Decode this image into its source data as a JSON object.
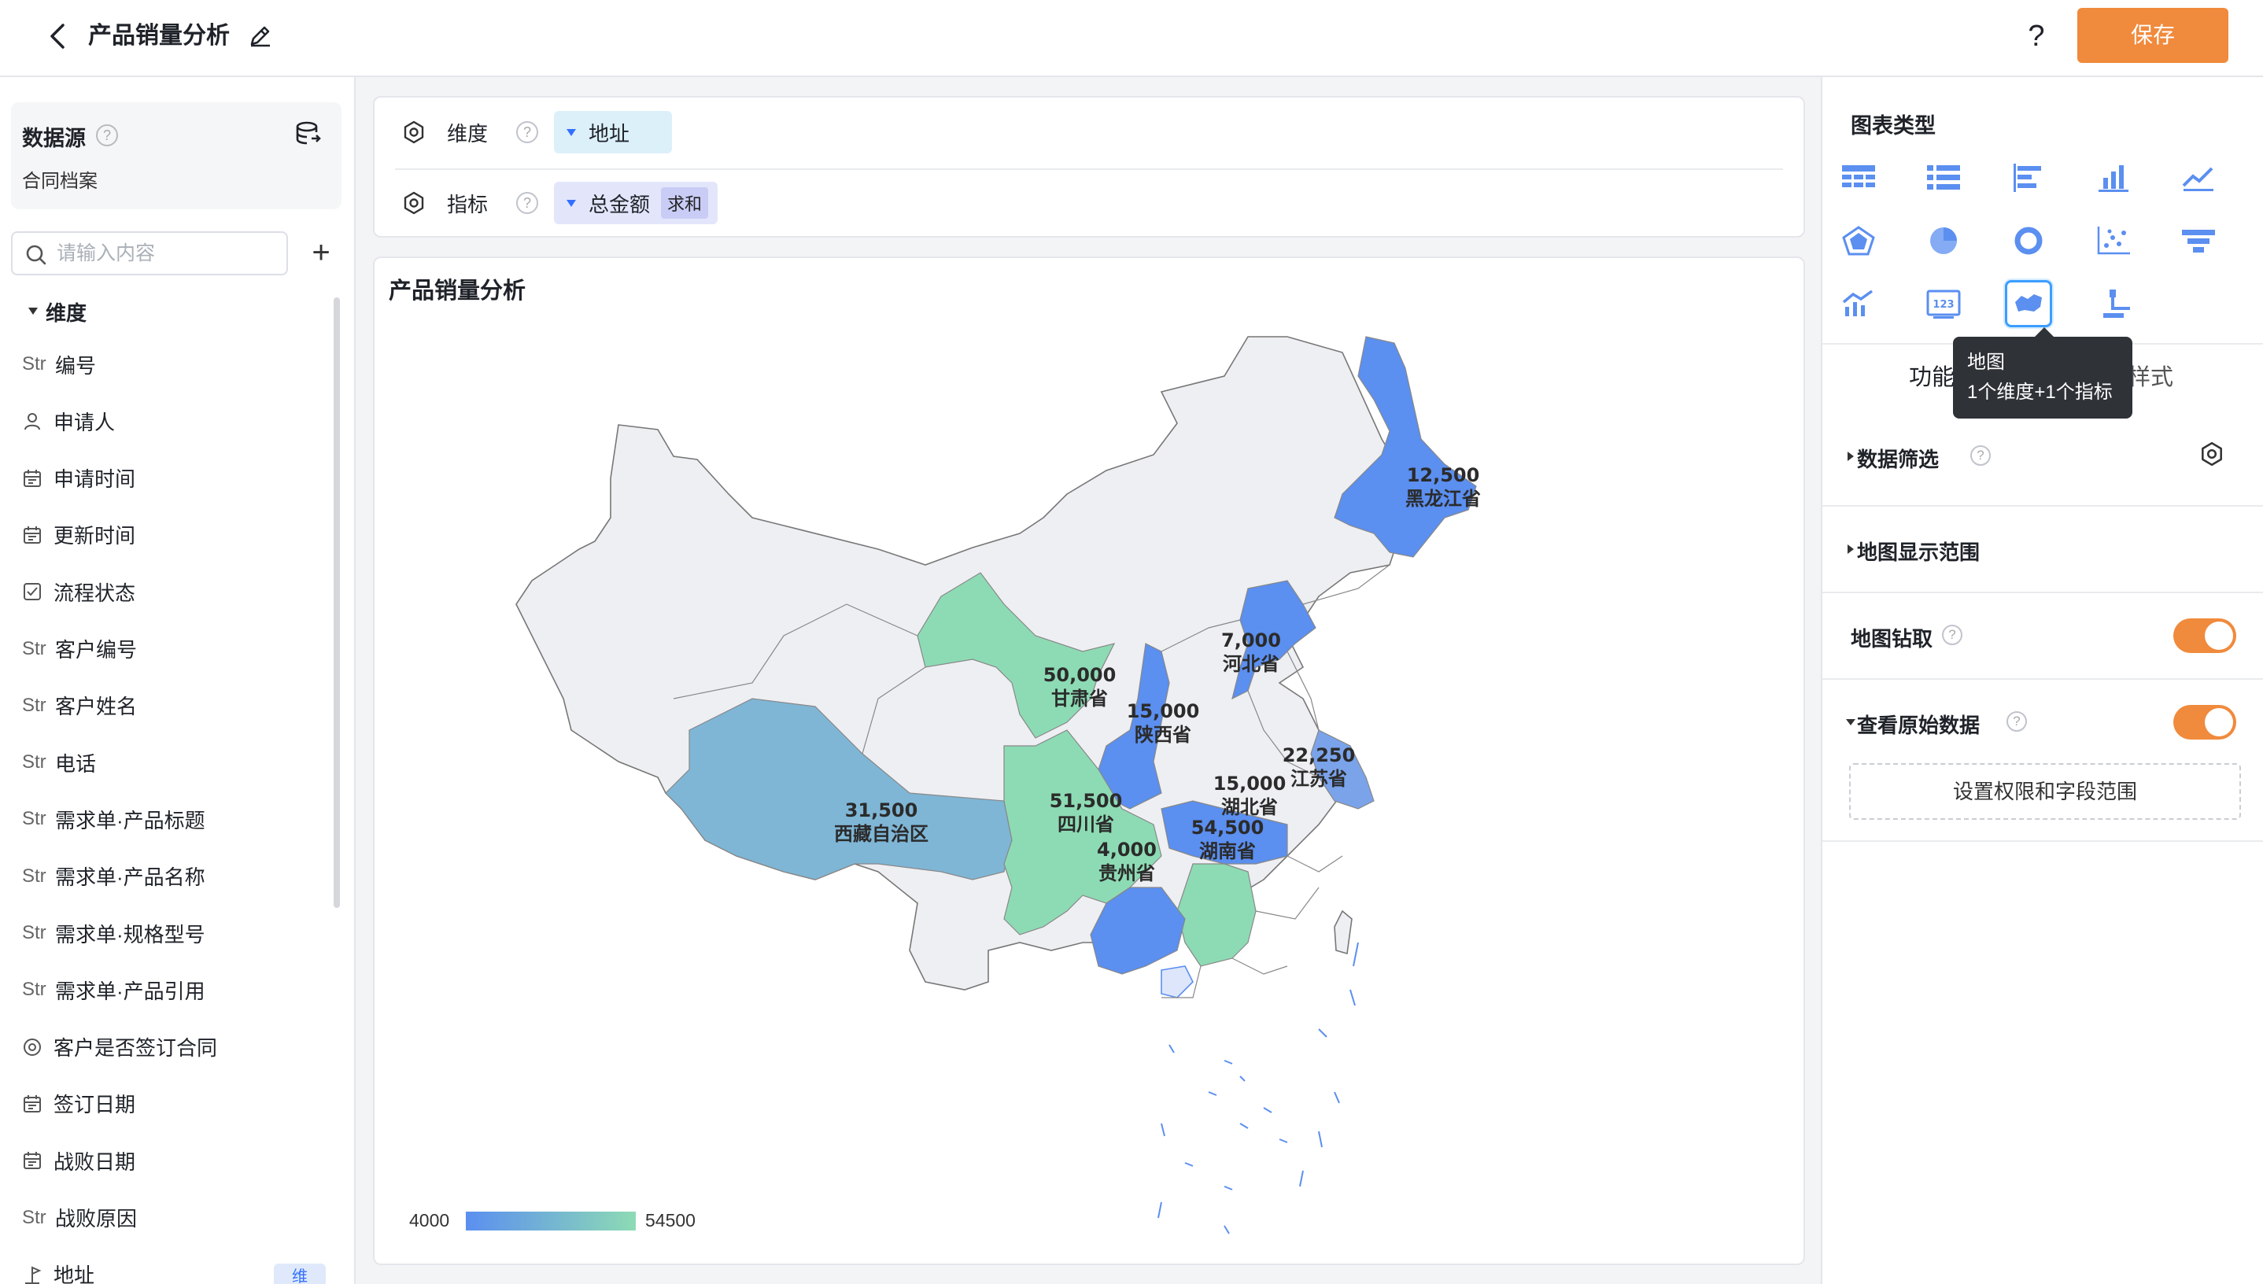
{
  "header": {
    "title": "产品销量分析",
    "help": "?",
    "save_label": "保存"
  },
  "sidebar": {
    "datasource_label": "数据源",
    "datasource_name": "合同档案",
    "search_placeholder": "请输入内容",
    "add": "+",
    "dimension_group": "维度",
    "fields": [
      {
        "type": "Str",
        "icon": "string-icon",
        "label": "编号"
      },
      {
        "type": "",
        "icon": "person-icon",
        "label": "申请人"
      },
      {
        "type": "",
        "icon": "calendar-icon",
        "label": "申请时间"
      },
      {
        "type": "",
        "icon": "calendar-icon",
        "label": "更新时间"
      },
      {
        "type": "",
        "icon": "checkbox-icon",
        "label": "流程状态"
      },
      {
        "type": "Str",
        "icon": "string-icon",
        "label": "客户编号"
      },
      {
        "type": "Str",
        "icon": "string-icon",
        "label": "客户姓名"
      },
      {
        "type": "Str",
        "icon": "string-icon",
        "label": "电话"
      },
      {
        "type": "Str",
        "icon": "string-icon",
        "label": "需求单·产品标题"
      },
      {
        "type": "Str",
        "icon": "string-icon",
        "label": "需求单·产品名称"
      },
      {
        "type": "Str",
        "icon": "string-icon",
        "label": "需求单·规格型号"
      },
      {
        "type": "Str",
        "icon": "string-icon",
        "label": "需求单·产品引用"
      },
      {
        "type": "",
        "icon": "radio-icon",
        "label": "客户是否签订合同"
      },
      {
        "type": "",
        "icon": "calendar-icon",
        "label": "签订日期"
      },
      {
        "type": "",
        "icon": "calendar-icon",
        "label": "战败日期"
      },
      {
        "type": "Str",
        "icon": "string-icon",
        "label": "战败原因"
      },
      {
        "type": "",
        "icon": "location-icon",
        "label": "地址"
      }
    ],
    "address_tag": "维"
  },
  "config": {
    "dimension_label": "维度",
    "dimension_value": "地址",
    "metric_label": "指标",
    "metric_value": "总金额",
    "metric_agg": "求和"
  },
  "chart": {
    "title": "产品销量分析",
    "legend_min": "4000",
    "legend_max": "54500",
    "colors": {
      "low": "#5b8ff0",
      "high": "#8ddbb4",
      "mid": "#7fb6d6",
      "base": "#eeeff3"
    }
  },
  "chart_data": {
    "type": "map",
    "region": "China",
    "title": "产品销量分析",
    "visual_range": [
      4000,
      54500
    ],
    "values": [
      {
        "name": "黑龙江省",
        "value": 12500,
        "value_label": "12,500"
      },
      {
        "name": "河北省",
        "value": 7000,
        "value_label": "7,000"
      },
      {
        "name": "甘肃省",
        "value": 50000,
        "value_label": "50,000"
      },
      {
        "name": "陕西省",
        "value": 15000,
        "value_label": "15,000"
      },
      {
        "name": "江苏省",
        "value": 22250,
        "value_label": "22,250"
      },
      {
        "name": "西藏自治区",
        "value": 31500,
        "value_label": "31,500"
      },
      {
        "name": "四川省",
        "value": 51500,
        "value_label": "51,500"
      },
      {
        "name": "湖北省",
        "value": 15000,
        "value_label": "15,000"
      },
      {
        "name": "湖南省",
        "value": 54500,
        "value_label": "54,500"
      },
      {
        "name": "贵州省",
        "value": 4000,
        "value_label": "4,000"
      }
    ]
  },
  "right_panel": {
    "chart_type_title": "图表类型",
    "chart_types": [
      "table-icon",
      "list-icon",
      "bar-horizontal-icon",
      "bar-chart-icon",
      "line-chart-icon",
      "radar-icon",
      "pie-icon",
      "donut-icon",
      "scatter-icon",
      "funnel-icon",
      "combo-chart-icon",
      "number-card-icon",
      "map-icon",
      "tree-icon"
    ],
    "tooltip_title": "地图",
    "tooltip_desc": "1个维度+1个指标",
    "tab_function": "功能",
    "tab_style": "样式",
    "data_filter": "数据筛选",
    "map_range": "地图显示范围",
    "map_drill": "地图钻取",
    "view_raw": "查看原始数据",
    "perm_button": "设置权限和字段范围"
  }
}
